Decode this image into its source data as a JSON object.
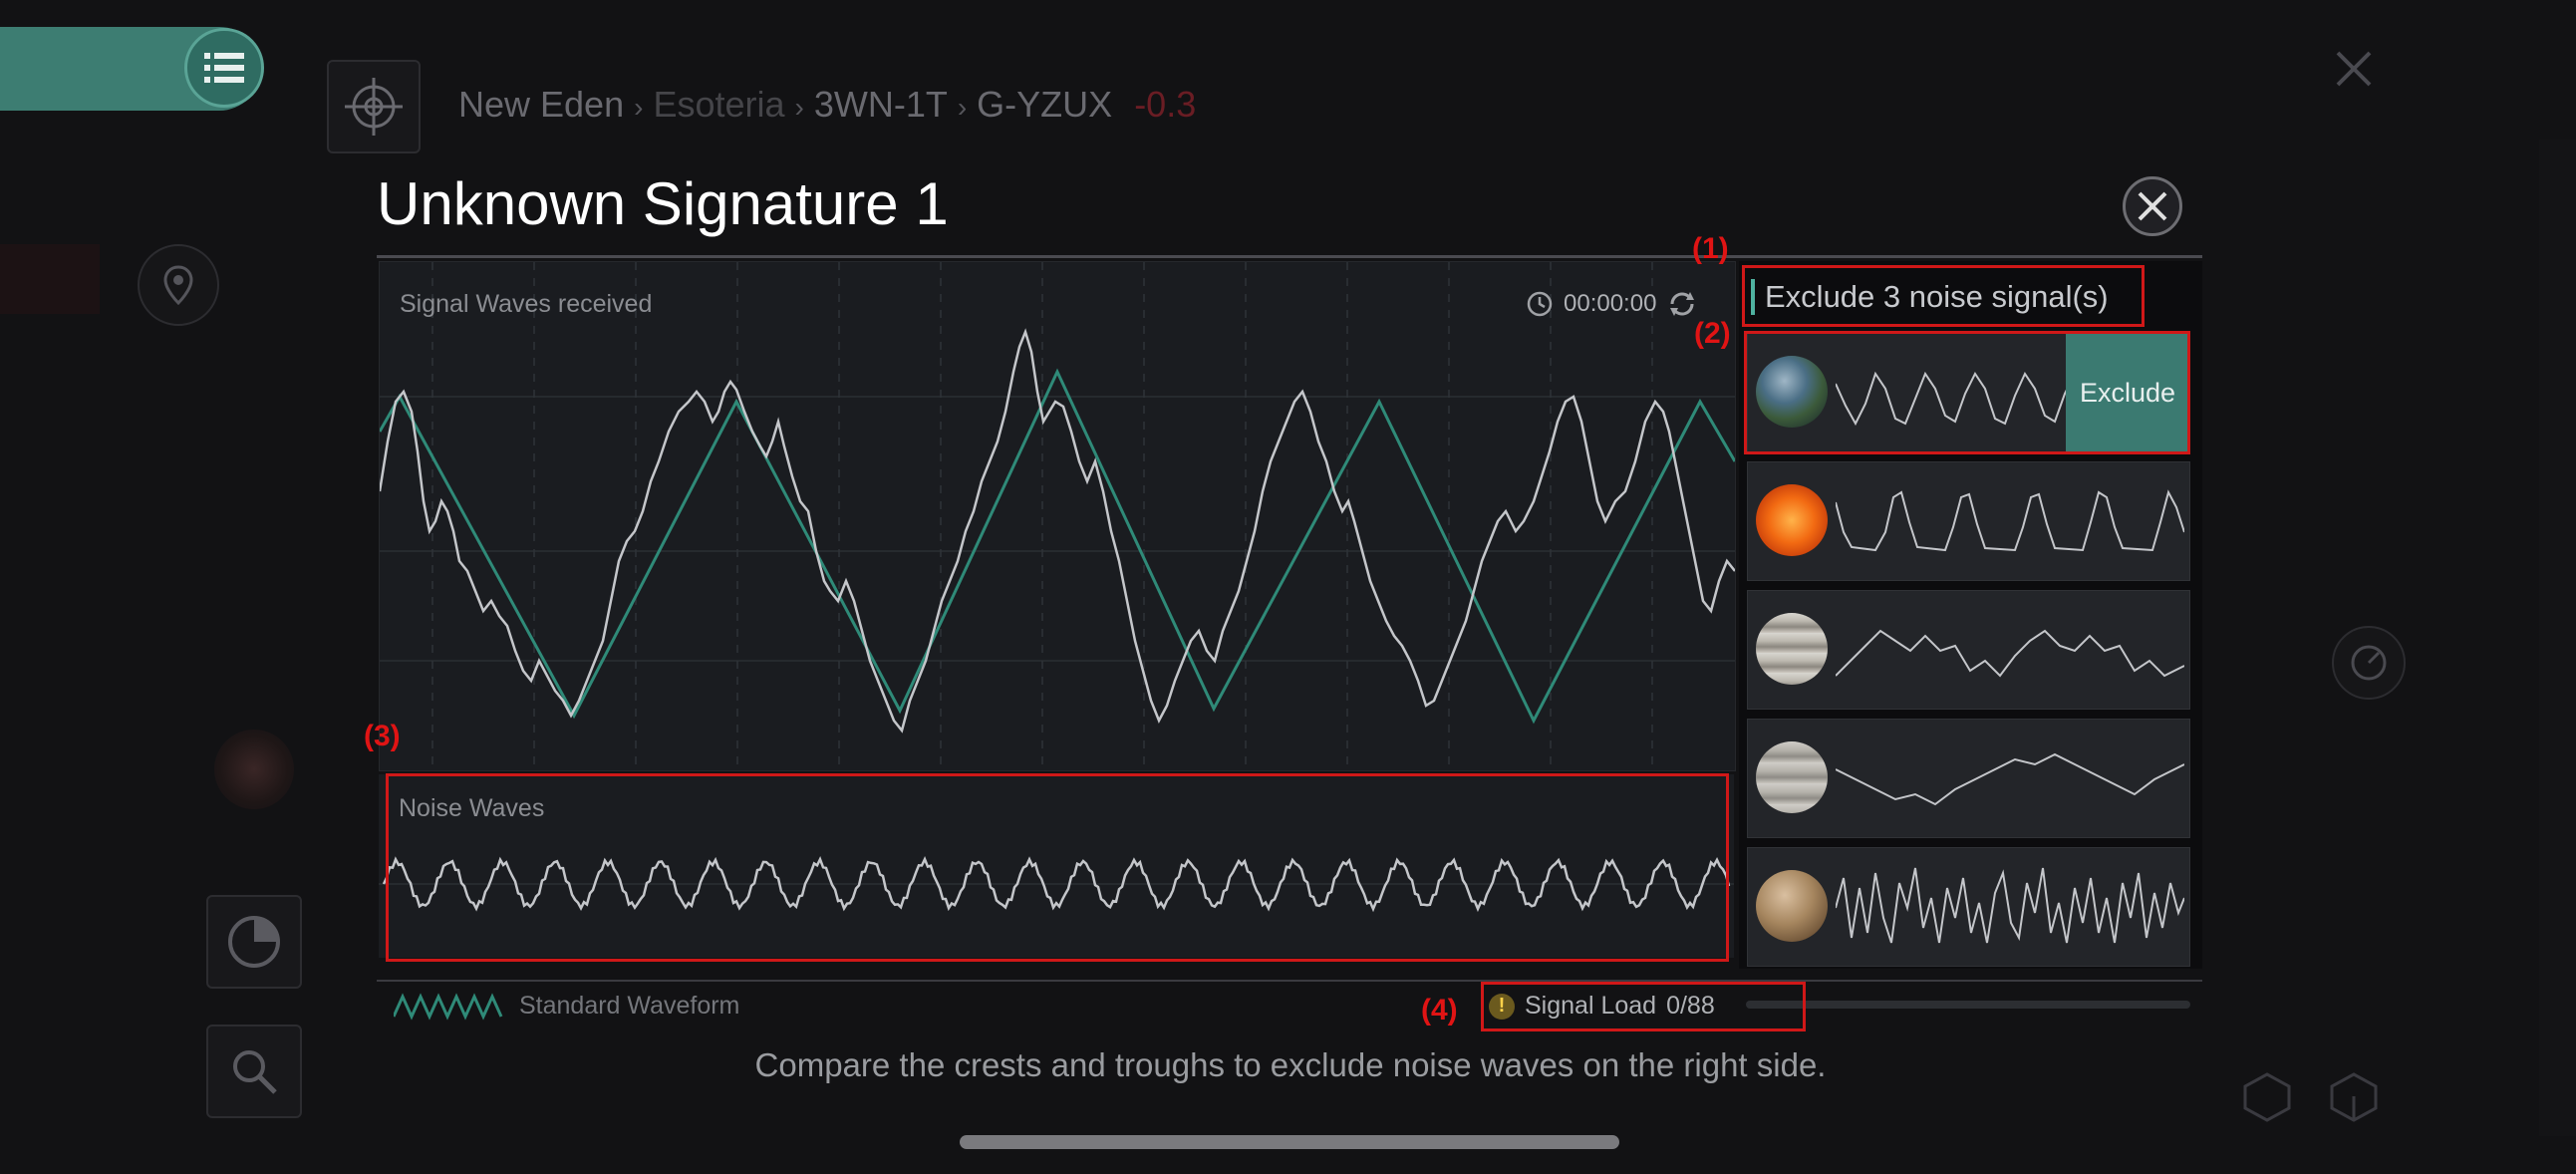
{
  "breadcrumb": {
    "region": "New Eden",
    "constellation": "Esoteria",
    "system_group": "3WN-1T",
    "system": "G-YZUX",
    "security": "-0.3"
  },
  "modal": {
    "title": "Unknown Signature 1",
    "signal_panel_label": "Signal Waves received",
    "timer": "00:00:00",
    "noise_panel_label": "Noise Waves",
    "legend_label": "Standard Waveform",
    "signal_load_label": "Signal Load",
    "signal_load_value": "0/88",
    "signal_load_progress": 0,
    "hint": "Compare the crests and troughs to exclude noise waves on the right side."
  },
  "exclude_panel": {
    "header": "Exclude 3 noise signal(s)",
    "button_label": "Exclude",
    "cards": [
      {
        "planet": "earth-like-planet",
        "selected": true
      },
      {
        "planet": "sun-star",
        "selected": false
      },
      {
        "planet": "gas-giant",
        "selected": false
      },
      {
        "planet": "gas-giant-pale",
        "selected": false
      },
      {
        "planet": "rocky-planet",
        "selected": false
      }
    ]
  },
  "annotations": {
    "a1": "(1)",
    "a2": "(2)",
    "a3": "(3)",
    "a4": "(4)"
  },
  "colors": {
    "accent": "#3d7d72",
    "standard_waveform": "#2f8a78",
    "annotation_red": "#d01818"
  }
}
